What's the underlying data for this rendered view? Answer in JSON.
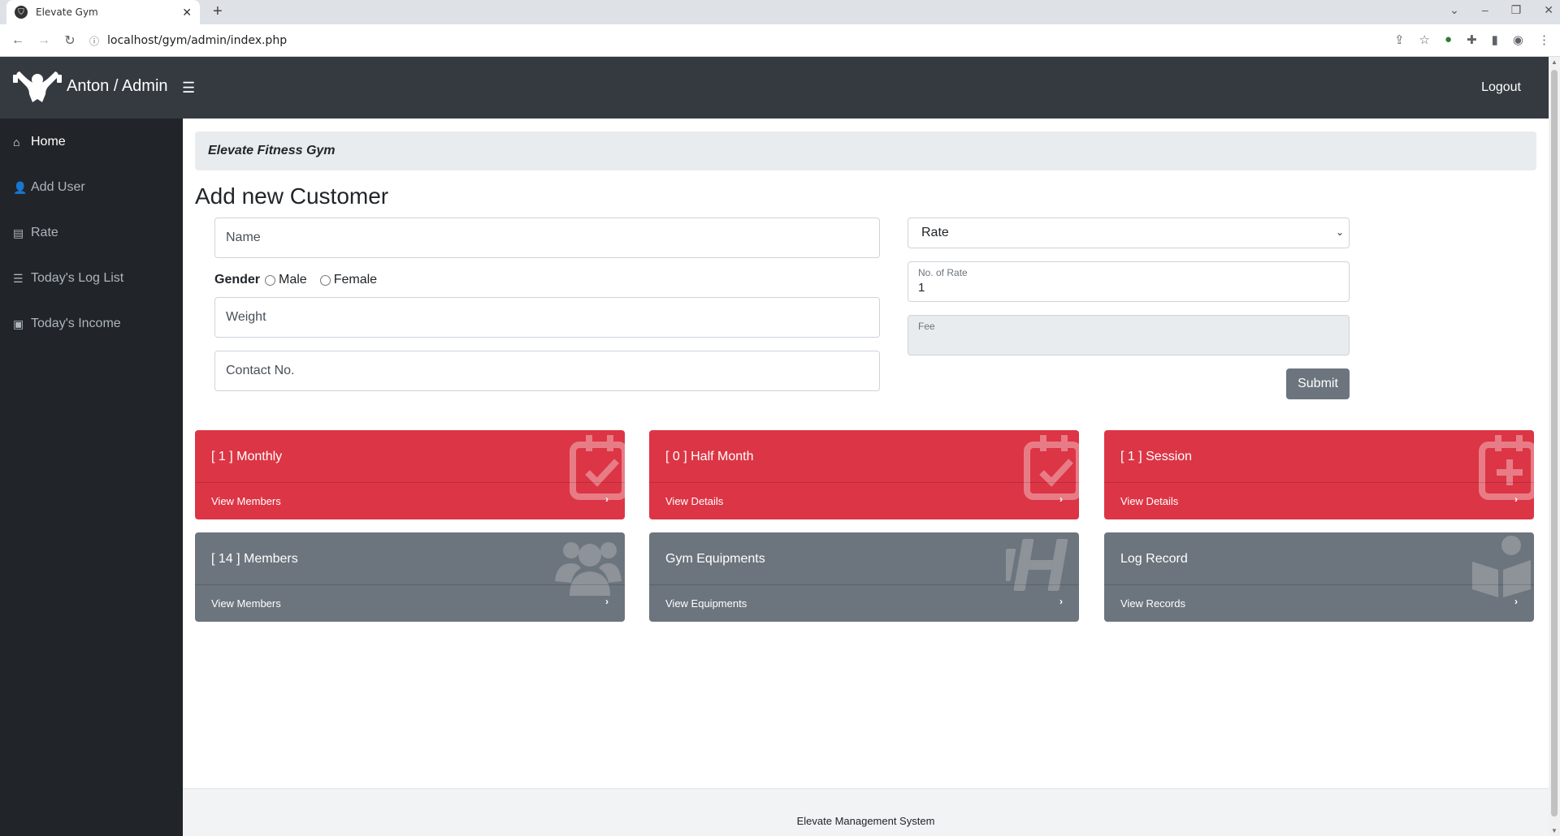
{
  "browser": {
    "tab_title": "Elevate Gym",
    "url": "localhost/gym/admin/index.php"
  },
  "header": {
    "brand": "Anton / Admin",
    "logout": "Logout"
  },
  "sidebar": {
    "items": [
      {
        "label": "Home",
        "icon": "home-icon"
      },
      {
        "label": "Add User",
        "icon": "user-check-icon"
      },
      {
        "label": "Rate",
        "icon": "rate-table-icon"
      },
      {
        "label": "Today's Log List",
        "icon": "list-icon"
      },
      {
        "label": "Today's Income",
        "icon": "money-icon"
      }
    ]
  },
  "main": {
    "breadcrumb": "Elevate Fitness Gym",
    "title": "Add new Customer",
    "form": {
      "name_placeholder": "Name",
      "gender_label": "Gender",
      "male": "Male",
      "female": "Female",
      "weight_placeholder": "Weight",
      "contact_placeholder": "Contact No.",
      "rate_selected": "Rate",
      "no_of_rate_label": "No. of Rate",
      "no_of_rate_value": "1",
      "fee_label": "Fee",
      "submit": "Submit"
    },
    "cards": [
      {
        "title": "[ 1 ] Monthly",
        "link": "View Members",
        "color": "#dc3545",
        "icon": "calendar-check-icon"
      },
      {
        "title": "[ 0 ] Half Month",
        "link": "View Details",
        "color": "#dc3545",
        "icon": "calendar-check-icon"
      },
      {
        "title": "[ 1 ] Session",
        "link": "View Details",
        "color": "#dc3545",
        "icon": "calendar-plus-icon"
      },
      {
        "title": "[ 14 ] Members",
        "link": "View Members",
        "color": "#6c757d",
        "icon": "users-icon"
      },
      {
        "title": "Gym Equipments",
        "link": "View Equipments",
        "color": "#6c757d",
        "icon": "dumbbell-icon"
      },
      {
        "title": "Log Record",
        "link": "View Records",
        "color": "#6c757d",
        "icon": "book-reader-icon"
      }
    ]
  },
  "footer": {
    "text": "Elevate Management System"
  }
}
